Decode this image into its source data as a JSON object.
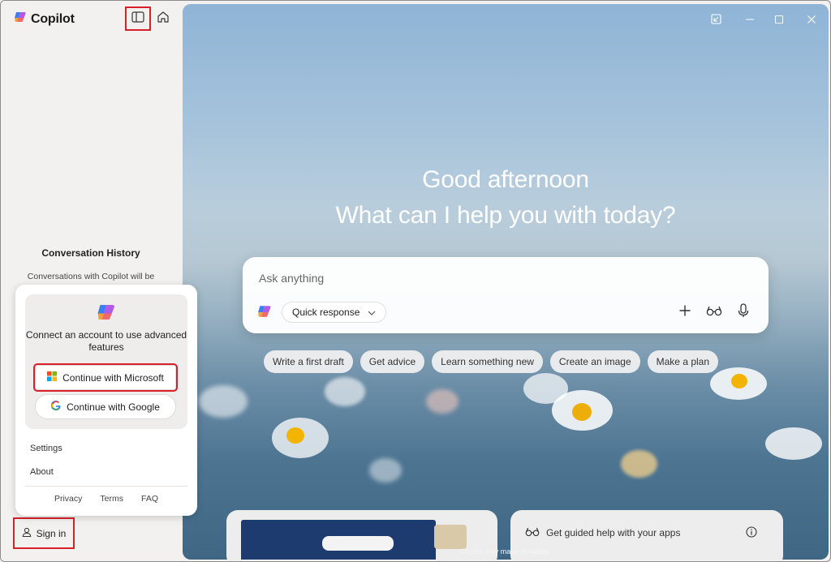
{
  "app": {
    "title": "Copilot"
  },
  "sidebar": {
    "history_title": "Conversation History",
    "history_subtitle": "Conversations with Copilot will be",
    "popover": {
      "message": "Connect an account to use advanced features",
      "continue_microsoft": "Continue with Microsoft",
      "continue_google": "Continue with Google",
      "settings": "Settings",
      "about": "About",
      "footer": [
        "Privacy",
        "Terms",
        "FAQ"
      ]
    },
    "sign_in": "Sign in"
  },
  "main": {
    "greeting": "Good afternoon",
    "question": "What can I help you with today?",
    "composer": {
      "placeholder": "Ask anything",
      "mode": "Quick response"
    },
    "suggestions": [
      "Write a first draft",
      "Get advice",
      "Learn something new",
      "Create an image",
      "Make a plan"
    ],
    "card_guided": "Get guided help with your apps",
    "disclaimer": "Copilot may make mistakes."
  },
  "colors": {
    "highlight": "#d8202a",
    "sky_top": "#8fb4d6",
    "sky_bottom": "#3f6784"
  },
  "icons": [
    "copilot-logo-icon",
    "sidebar-toggle-icon",
    "home-icon",
    "pop-out-icon",
    "minimize-icon",
    "maximize-icon",
    "close-icon",
    "chevron-down-icon",
    "plus-icon",
    "glasses-icon",
    "microphone-icon",
    "microsoft-logo-icon",
    "google-logo-icon",
    "person-icon",
    "info-icon"
  ]
}
